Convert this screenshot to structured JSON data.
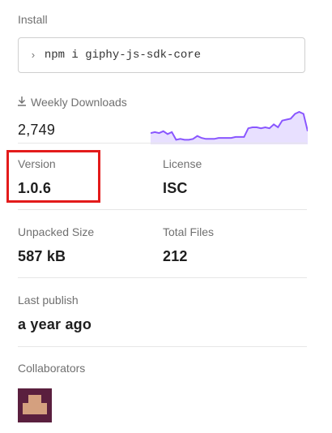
{
  "install": {
    "label": "Install",
    "command_prompt": "›",
    "command": "npm i giphy-js-sdk-core"
  },
  "downloads": {
    "label": "Weekly Downloads",
    "icon": "download-icon",
    "count": "2,749",
    "sparkline_color": "#8956ff",
    "sparkline_fill": "#e8e0ff",
    "sparkline": [
      10,
      11,
      10,
      12,
      9,
      11,
      3,
      4,
      3,
      3,
      4,
      7,
      5,
      4,
      4,
      4,
      5,
      5,
      5,
      5,
      6,
      6,
      6,
      15,
      16,
      16,
      15,
      16,
      15,
      19,
      16,
      23,
      24,
      25,
      30,
      32,
      30,
      12
    ]
  },
  "version": {
    "label": "Version",
    "value": "1.0.6"
  },
  "license": {
    "label": "License",
    "value": "ISC"
  },
  "unpacked_size": {
    "label": "Unpacked Size",
    "value": "587 kB"
  },
  "total_files": {
    "label": "Total Files",
    "value": "212"
  },
  "last_publish": {
    "label": "Last publish",
    "value": "a year ago"
  },
  "collaborators": {
    "label": "Collaborators",
    "avatar_colors": [
      "#5a1f3e",
      "#d4a07f"
    ]
  },
  "highlight_color": "#e31b1b"
}
